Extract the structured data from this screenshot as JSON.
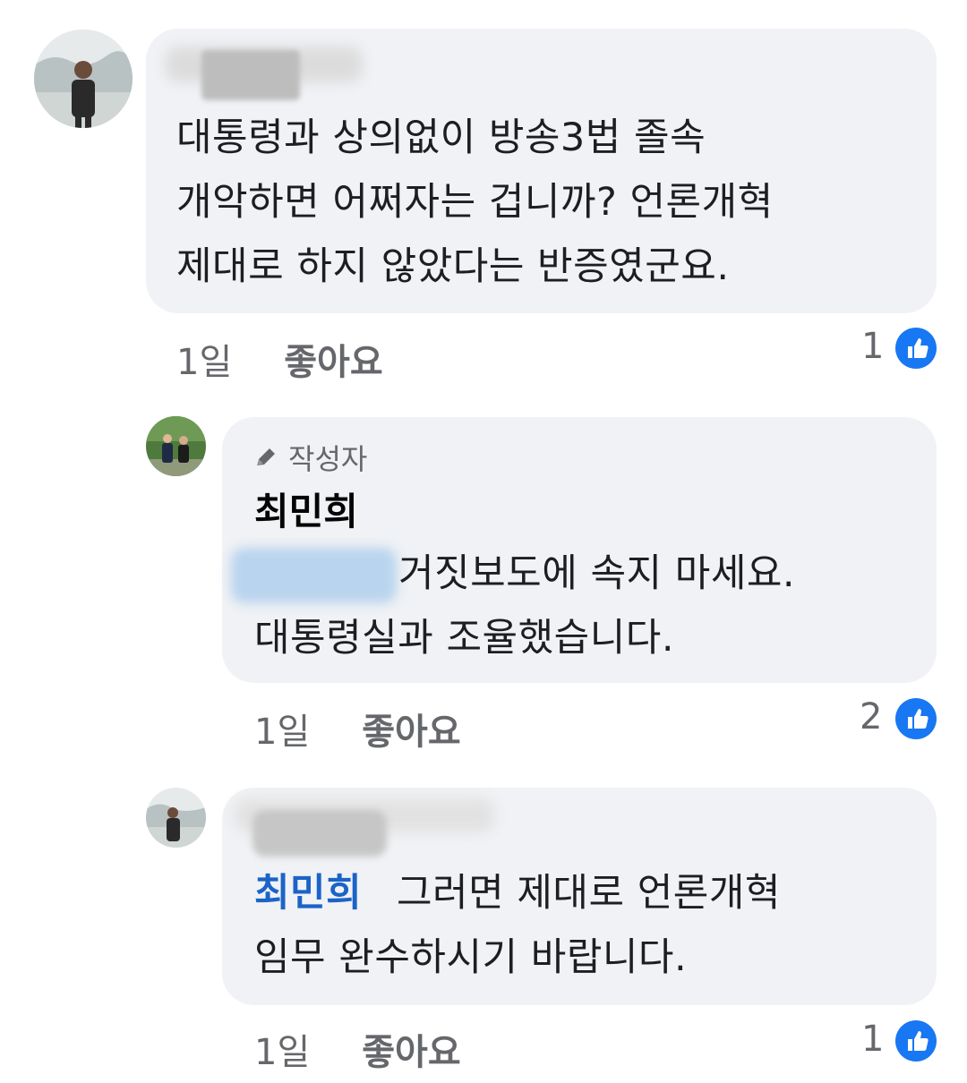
{
  "comments": [
    {
      "text_lines": [
        "대통령과 상의없이 방송3법 졸속",
        "개악하면 어쩌자는 겁니까? 언론개혁",
        "제대로 하지 않았다는 반증였군요."
      ],
      "time": "1일",
      "like_label": "좋아요",
      "reaction_count": "1"
    },
    {
      "badge": "작성자",
      "author": "최민희",
      "line1_rest": "거짓보도에 속지 마세요.",
      "line2": "대통령실과 조율했습니다.",
      "time": "1일",
      "like_label": "좋아요",
      "reaction_count": "2"
    },
    {
      "mention": "최민희",
      "line1_rest": "그러면 제대로 언론개혁",
      "line2": "임무 완수하시기 바랍니다.",
      "time": "1일",
      "like_label": "좋아요",
      "reaction_count": "1"
    }
  ],
  "icons": {
    "reaction": "thumbs-up-icon",
    "author_badge": "pencil-icon"
  },
  "colors": {
    "bubble": "#f0f2f5",
    "mention": "#1b63c8",
    "like_reaction": "#1877f2",
    "meta_text": "#65676b"
  }
}
